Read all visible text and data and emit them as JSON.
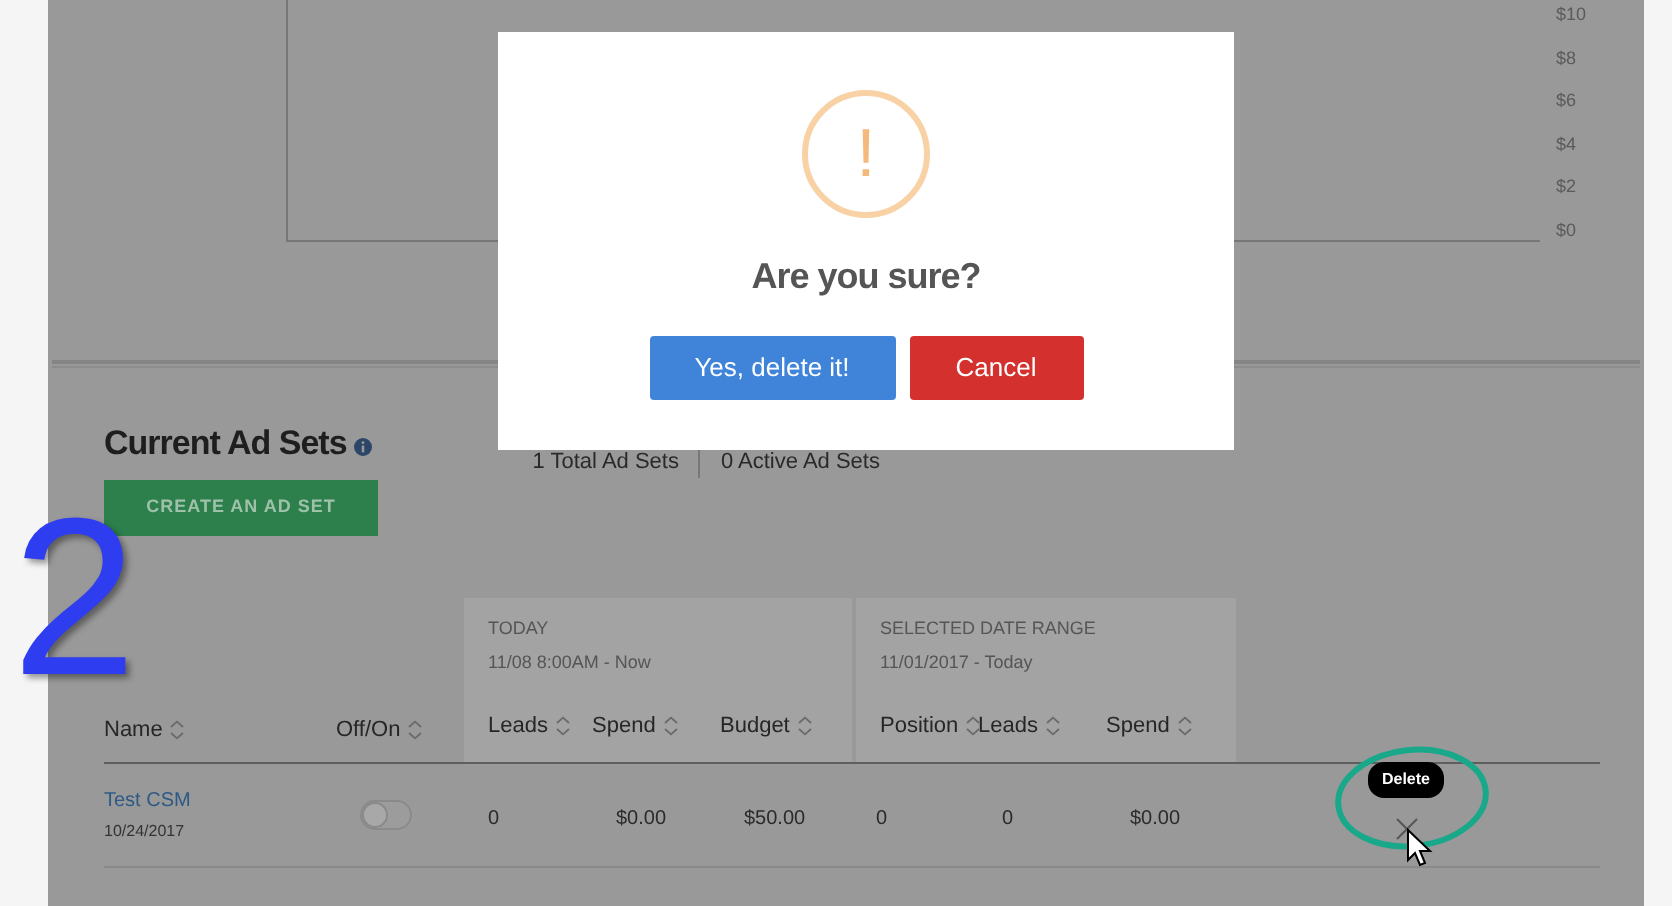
{
  "chart": {
    "y_axis_labels": [
      "$10",
      "$8",
      "$6",
      "$4",
      "$2",
      "$0"
    ]
  },
  "section": {
    "title": "Current Ad Sets",
    "summary": [
      "1 Total Ad Sets",
      "0 Active Ad Sets"
    ],
    "create_button": "CREATE AN AD SET"
  },
  "table": {
    "columns": [
      "Name",
      "Off/On"
    ],
    "groups": [
      {
        "title": "TODAY",
        "subtitle": "11/08 8:00AM - Now",
        "columns": [
          "Leads",
          "Spend",
          "Budget"
        ]
      },
      {
        "title": "SELECTED DATE RANGE",
        "subtitle": "11/01/2017 - Today",
        "columns": [
          "Position",
          "Leads",
          "Spend"
        ]
      }
    ],
    "rows": [
      {
        "name": "Test CSM",
        "date": "10/24/2017",
        "on": false,
        "cells": [
          "0",
          "$0.00",
          "$50.00",
          "0",
          "0",
          "$0.00"
        ],
        "delete_tooltip": "Delete"
      }
    ]
  },
  "annotation": {
    "label": "2"
  },
  "dialog": {
    "icon_text": "!",
    "title": "Are you sure?",
    "buttons": [
      {
        "label": "Yes, delete it!",
        "kind": "confirm"
      },
      {
        "label": "Cancel",
        "kind": "cancel"
      }
    ]
  }
}
